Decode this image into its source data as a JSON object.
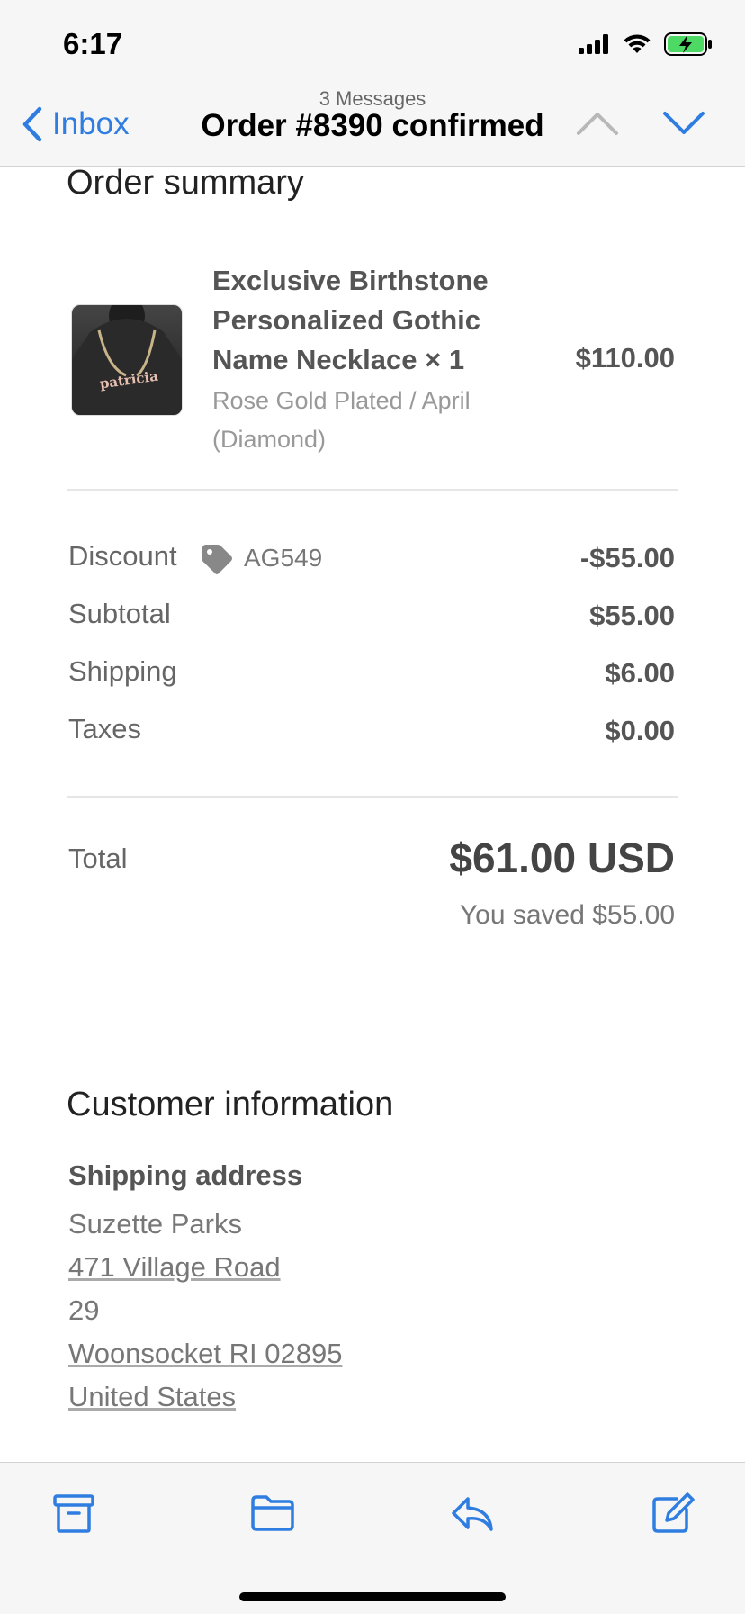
{
  "status_bar": {
    "time": "6:17"
  },
  "nav": {
    "back_label": "Inbox",
    "message_count": "3 Messages",
    "title": "Order #8390 confirmed"
  },
  "order_summary": {
    "heading": "Order summary",
    "item": {
      "name": "Exclusive Birthstone Personalized Gothic Name Necklace × 1",
      "variant": "Rose Gold Plated / April (Diamond)",
      "price": "$110.00",
      "image_text": "patricia"
    },
    "discount": {
      "label": "Discount",
      "code": "AG549",
      "value": "-$55.00"
    },
    "subtotal": {
      "label": "Subtotal",
      "value": "$55.00"
    },
    "shipping": {
      "label": "Shipping",
      "value": "$6.00"
    },
    "taxes": {
      "label": "Taxes",
      "value": "$0.00"
    },
    "total": {
      "label": "Total",
      "value": "$61.00 USD",
      "saved": "You saved $55.00"
    }
  },
  "customer_info": {
    "heading": "Customer information",
    "shipping_address": {
      "heading": "Shipping address",
      "name": "Suzette Parks",
      "street": "471 Village Road",
      "unit": "29",
      "city_line": "Woonsocket RI 02895",
      "country": "United States"
    }
  },
  "toolbar": {
    "icons": [
      "archive-icon",
      "folder-icon",
      "reply-icon",
      "compose-icon"
    ]
  },
  "colors": {
    "accent": "#2f7de1",
    "battery": "#4cd964"
  }
}
